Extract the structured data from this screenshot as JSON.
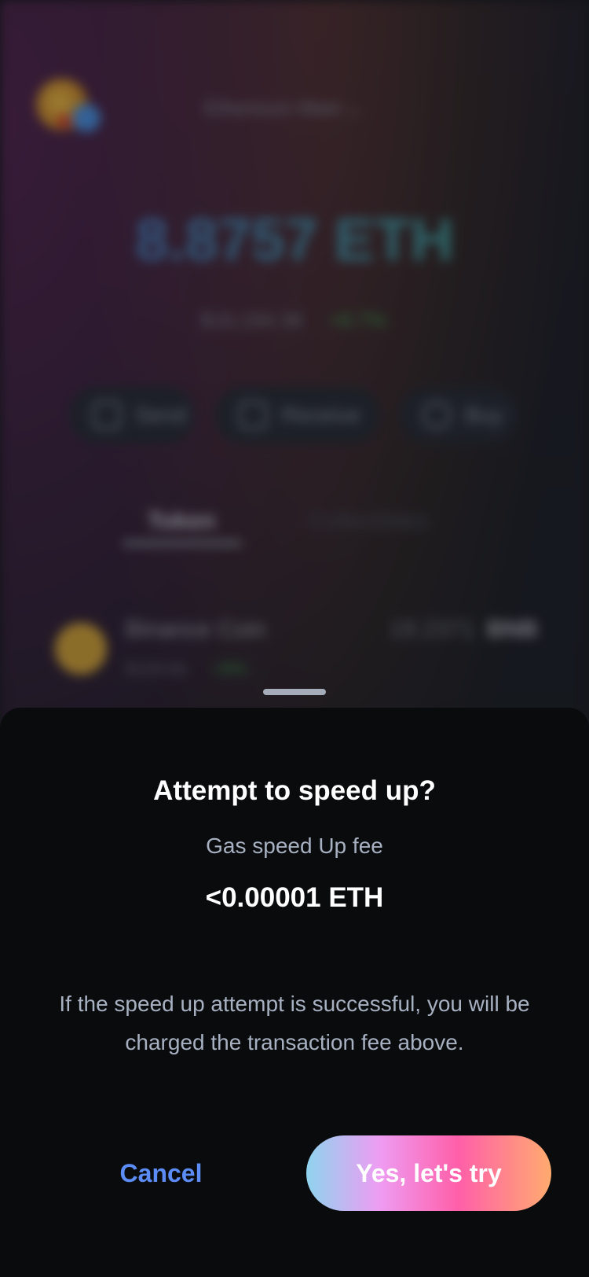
{
  "background": {
    "network_name": "Ethereum Main",
    "balance": "8.8757 ETH",
    "fiat_value": "$16,194.38",
    "fiat_change": "+8.7%",
    "actions": [
      {
        "label": "Send",
        "icon": "send-icon"
      },
      {
        "label": "Receive",
        "icon": "receive-icon"
      },
      {
        "label": "Buy",
        "icon": "buy-icon"
      }
    ],
    "tabs": [
      "Token",
      "Collectibles"
    ],
    "token_row": {
      "name": "Binance Coin",
      "price": "$120.81",
      "change": "+8%",
      "amount": "19.2371",
      "symbol": "BNB"
    }
  },
  "sheet": {
    "title": "Attempt to speed up?",
    "fee_label": "Gas speed Up fee",
    "fee_value": "<0.00001 ETH",
    "note": "If the speed up attempt is successful, you will be charged the transaction fee above.",
    "cancel_label": "Cancel",
    "confirm_label": "Yes, let's try"
  },
  "colors": {
    "accent_blue": "#5c8cf6",
    "sheet_bg": "#0a0b0d",
    "confirm_gradient": [
      "#8fd4ee",
      "#ee9cf2",
      "#ff5fa9",
      "#ffab6f"
    ]
  }
}
